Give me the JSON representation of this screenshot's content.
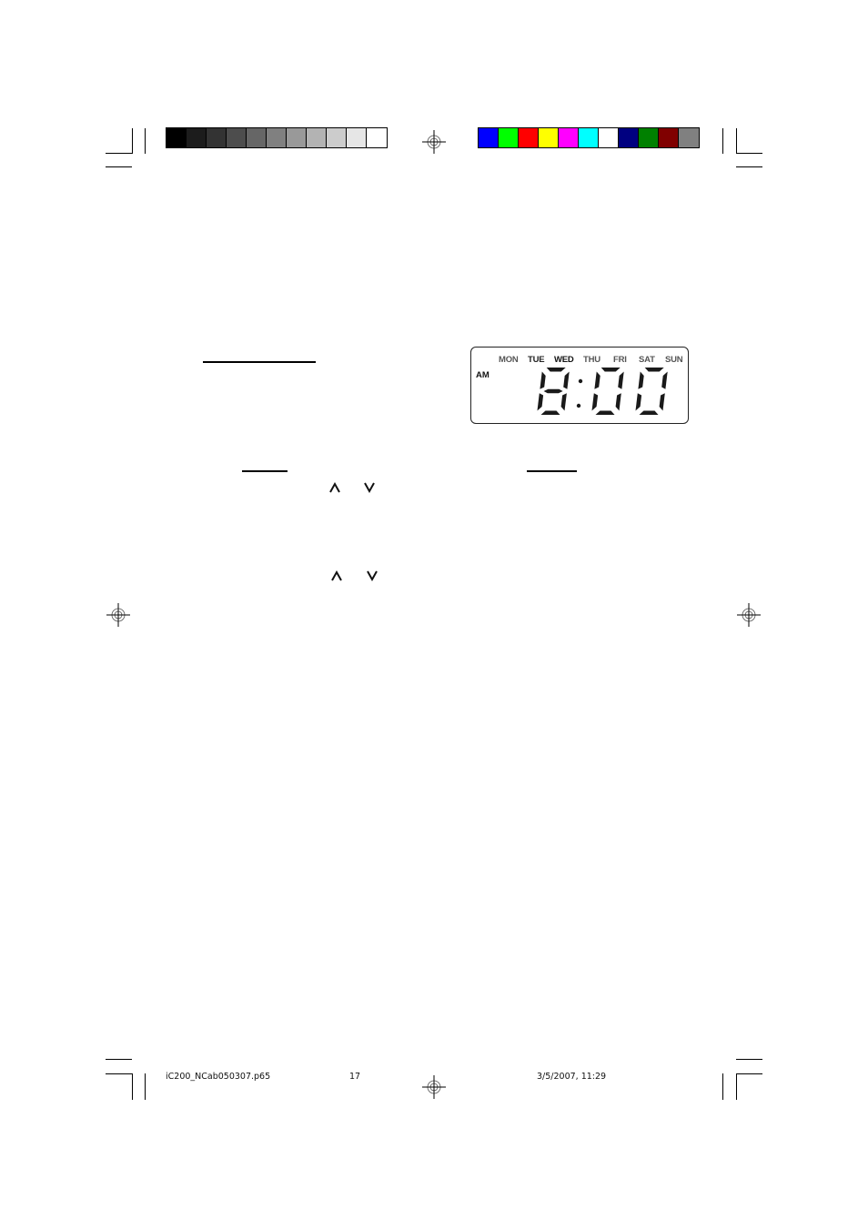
{
  "page": {
    "type": "printer proof page",
    "background": "#ffffff"
  },
  "color_bars": {
    "grayscale": [
      "#000000",
      "#1c1c1c",
      "#333333",
      "#4d4d4d",
      "#666666",
      "#808080",
      "#999999",
      "#b3b3b3",
      "#cccccc",
      "#e6e6e6",
      "#ffffff"
    ],
    "colors": [
      "#0000ff",
      "#00ff00",
      "#ff0000",
      "#ffff00",
      "#ff00ff",
      "#00ffff",
      "#ffffff",
      "#000080",
      "#008000",
      "#800000",
      "#808080"
    ]
  },
  "lcd_display": {
    "days": [
      {
        "label": "MON",
        "active": false
      },
      {
        "label": "TUE",
        "active": false
      },
      {
        "label": "WED",
        "active": true
      },
      {
        "label": "THU",
        "active": false
      },
      {
        "label": "FRI",
        "active": false
      },
      {
        "label": "SAT",
        "active": false
      },
      {
        "label": "SUN",
        "active": false
      }
    ],
    "period": "AM",
    "time": "8:00",
    "hour_digit": "8",
    "minute_digits": [
      "0",
      "0"
    ]
  },
  "controls": {
    "up_arrow_icon": "up-chevron",
    "down_arrow_icon": "down-chevron"
  },
  "footer": {
    "filename": "iC200_NCab050307.p65",
    "page_number": "17",
    "datetime": "3/5/2007, 11:29"
  }
}
